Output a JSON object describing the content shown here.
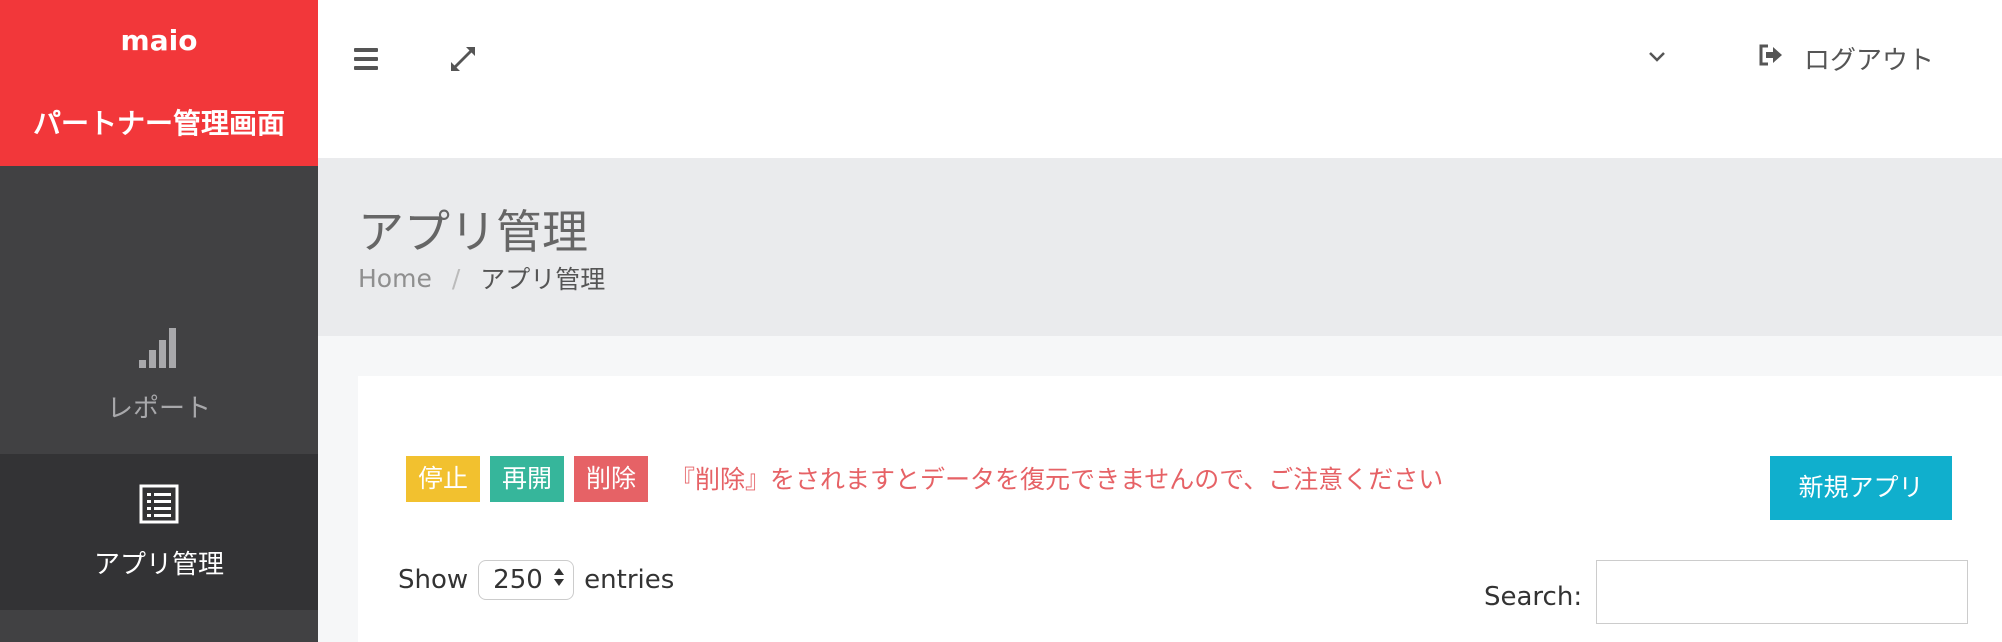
{
  "sidebar": {
    "brand_name": "maio",
    "brand_subtitle": "パートナー管理画面",
    "items": [
      {
        "label": "レポート",
        "icon": "bar-chart-icon"
      },
      {
        "label": "アプリ管理",
        "icon": "list-icon"
      }
    ]
  },
  "header": {
    "logout_label": "ログアウト"
  },
  "page": {
    "title": "アプリ管理",
    "breadcrumb": {
      "home": "Home",
      "separator": "/",
      "current": "アプリ管理"
    }
  },
  "actions": {
    "stop": "停止",
    "resume": "再開",
    "delete": "削除",
    "warning": "『削除』をされますとデータを復元できませんので、ご注意ください",
    "new_app": "新規アプリ"
  },
  "table_controls": {
    "show_label": "Show",
    "entries_value": "250",
    "entries_label": "entries",
    "search_label": "Search:",
    "search_value": ""
  },
  "colors": {
    "brand": "#f2373a",
    "sidebar_bg": "#414143",
    "sidebar_active": "#333335",
    "stop": "#f2c12f",
    "resume": "#36b69b",
    "delete": "#e66266",
    "primary": "#10afcd"
  }
}
